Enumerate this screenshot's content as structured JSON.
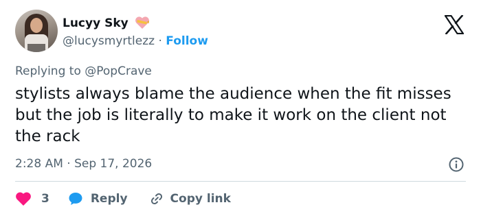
{
  "author": {
    "display_name": "Lucyy Sky",
    "handle": "@lucysmyrtlezz",
    "separator": "·",
    "follow_label": "Follow"
  },
  "reply_context": {
    "prefix": "Replying to",
    "mention": "@PopCrave"
  },
  "tweet": {
    "text": "stylists always blame the audience when the fit misses but the job is literally to make it work on the client not the rack",
    "timestamp": "2:28 AM · Sep 17, 2026"
  },
  "actions": {
    "like_count": "3",
    "reply_label": "Reply",
    "copy_link_label": "Copy link"
  },
  "icons": {
    "badge": "heart-ribbon-icon",
    "brand": "x-logo-icon",
    "info": "info-icon",
    "like": "heart-icon",
    "reply": "speech-bubble-icon",
    "copy": "link-icon"
  },
  "colors": {
    "link": "#1d9bf0",
    "secondary_text": "#536471",
    "like": "#f91880",
    "divider": "#cfd9de"
  }
}
